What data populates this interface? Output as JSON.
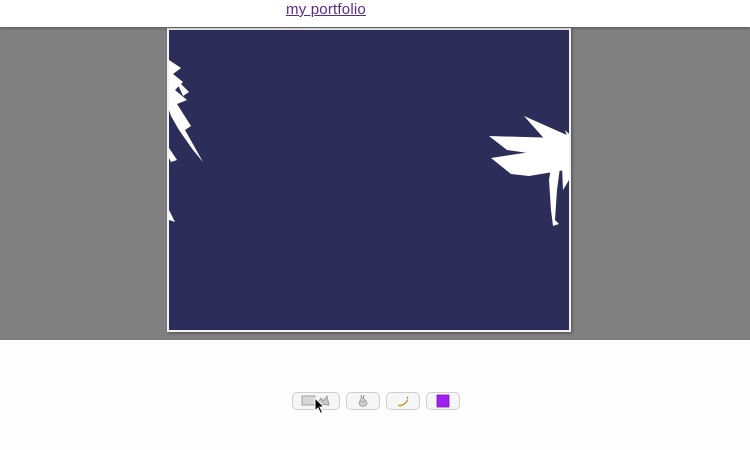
{
  "header": {
    "link_label": "my portfolio"
  },
  "stage": {
    "canvas_background": "#2d2d5a",
    "frame_background": "#808080",
    "shape_color": "#ffffff"
  },
  "toolbar": {
    "buttons": [
      {
        "name": "landscape-bird-icon",
        "label": ""
      },
      {
        "name": "rabbit-icon",
        "label": ""
      },
      {
        "name": "banana-icon",
        "label": ""
      },
      {
        "name": "purple-square-icon",
        "label": ""
      }
    ]
  },
  "colors": {
    "link": "#5a2a8a",
    "purple_square": "#a020f0",
    "banana": "#f2c230"
  }
}
